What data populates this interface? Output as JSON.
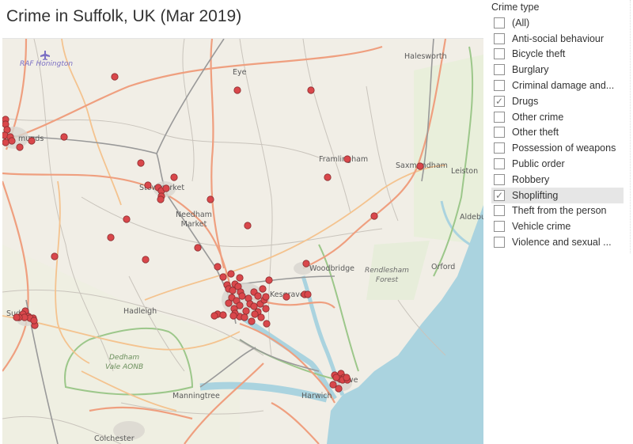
{
  "title": "Crime in Suffolk, UK (Mar 2019)",
  "map": {
    "marker_color": "#d9474b",
    "marker_stroke": "#8b2e30",
    "water_color": "#aad3df",
    "places": [
      {
        "name": "RAF Honington",
        "style": "raf"
      },
      {
        "name": "Eye",
        "style": "town"
      },
      {
        "name": "Halesworth",
        "style": "town"
      },
      {
        "name": "Bury St Edmunds",
        "style": "town"
      },
      {
        "name": "Framlingham",
        "style": "town"
      },
      {
        "name": "Saxmundham",
        "style": "town"
      },
      {
        "name": "Leiston",
        "style": "town"
      },
      {
        "name": "Stowmarket",
        "style": "town"
      },
      {
        "name": "Needham Market",
        "style": "town"
      },
      {
        "name": "Aldeburgh",
        "style": "town"
      },
      {
        "name": "Woodbridge",
        "style": "town"
      },
      {
        "name": "Rendlesham Forest",
        "style": "italic"
      },
      {
        "name": "Orford",
        "style": "town"
      },
      {
        "name": "Kesgrave",
        "style": "town"
      },
      {
        "name": "Hadleigh",
        "style": "town"
      },
      {
        "name": "Sudbury",
        "style": "town"
      },
      {
        "name": "Dedham Vale AONB",
        "style": "italic"
      },
      {
        "name": "Felixstowe",
        "style": "town"
      },
      {
        "name": "Manningtree",
        "style": "town"
      },
      {
        "name": "Harwich",
        "style": "town"
      },
      {
        "name": "Colchester",
        "style": "town"
      }
    ],
    "incident_count_visible": 112
  },
  "filter": {
    "title": "Crime type",
    "items": [
      {
        "label": "(All)",
        "checked": false
      },
      {
        "label": "Anti-social behaviour",
        "checked": false
      },
      {
        "label": "Bicycle theft",
        "checked": false
      },
      {
        "label": "Burglary",
        "checked": false
      },
      {
        "label": "Criminal damage and...",
        "checked": false
      },
      {
        "label": "Drugs",
        "checked": true
      },
      {
        "label": "Other crime",
        "checked": false
      },
      {
        "label": "Other theft",
        "checked": false
      },
      {
        "label": "Possession of weapons",
        "checked": false
      },
      {
        "label": "Public order",
        "checked": false
      },
      {
        "label": "Robbery",
        "checked": false
      },
      {
        "label": "Shoplifting",
        "checked": true,
        "hovered": true
      },
      {
        "label": "Theft from the person",
        "checked": false
      },
      {
        "label": "Vehicle crime",
        "checked": false
      },
      {
        "label": "Violence and sexual ...",
        "checked": false
      }
    ]
  }
}
